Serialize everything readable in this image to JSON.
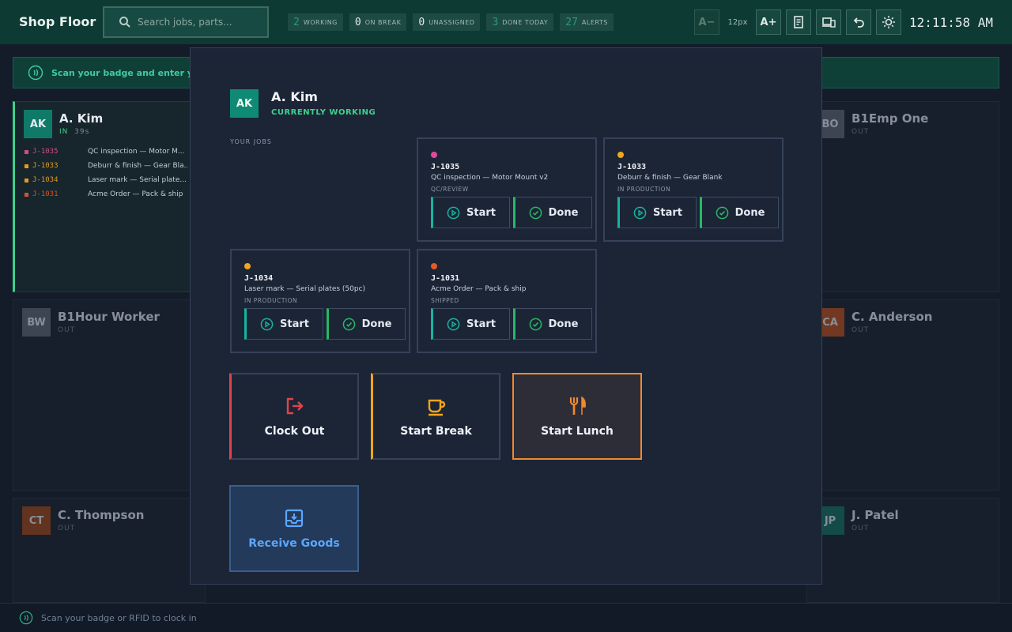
{
  "topbar": {
    "title": "Shop Floor",
    "search_placeholder": "Search jobs, parts...",
    "stats": [
      {
        "num": "2",
        "label": "WORKING"
      },
      {
        "num": "0",
        "label": "ON BREAK"
      },
      {
        "num": "0",
        "label": "UNASSIGNED"
      },
      {
        "num": "3",
        "label": "DONE TODAY"
      },
      {
        "num": "27",
        "label": "ALERTS"
      }
    ],
    "font_decrease": "A−",
    "font_size": "12px",
    "font_increase": "A+",
    "clock": "12:11:58 AM"
  },
  "banner": {
    "text": "Scan your badge and enter your PIN"
  },
  "cards": [
    {
      "initials": "AK",
      "name": "A. Kim",
      "status": "IN",
      "duration": "39s",
      "avatar_color": "#0f7a68",
      "jobs": [
        {
          "id": "J-1035",
          "desc": "QC inspection — Motor M...",
          "color": "#d04a8d"
        },
        {
          "id": "J-1033",
          "desc": "Deburr & finish — Gear Bla...",
          "color": "#e59a1b"
        },
        {
          "id": "J-1034",
          "desc": "Laser mark — Serial plate...",
          "color": "#e59a1b"
        },
        {
          "id": "J-1031",
          "desc": "Acme Order — Pack & ship",
          "color": "#d5532a"
        }
      ]
    },
    {
      "initials": "BO",
      "name": "B1Emp One",
      "status": "OUT",
      "avatar_color": "#5f6773"
    },
    {
      "initials": "BW",
      "name": "B1Hour Worker",
      "status": "OUT",
      "avatar_color": "#5f6773"
    },
    {
      "initials": "CA",
      "name": "C. Anderson",
      "status": "OUT",
      "avatar_color": "#c0501b"
    },
    {
      "initials": "CT",
      "name": "C. Thompson",
      "status": "OUT",
      "avatar_color": "#a24717"
    },
    {
      "initials": "JP",
      "name": "J. Patel",
      "status": "OUT",
      "avatar_color": "#137261"
    }
  ],
  "footer": {
    "text": "Scan your badge or RFID to clock in"
  },
  "modal": {
    "initials": "AK",
    "name": "A. Kim",
    "status": "CURRENTLY WORKING",
    "jobs_heading": "YOUR JOBS",
    "jobs": [
      {
        "id": "J-1035",
        "desc": "QC inspection — Motor Mount v2",
        "status": "QC/REVIEW",
        "color": "#e04a9a"
      },
      {
        "id": "J-1033",
        "desc": "Deburr & finish — Gear Blank",
        "status": "IN PRODUCTION",
        "color": "#f0a51c"
      },
      {
        "id": "J-1034",
        "desc": "Laser mark — Serial plates (50pc)",
        "status": "IN PRODUCTION",
        "color": "#f0a51c"
      },
      {
        "id": "J-1031",
        "desc": "Acme Order — Pack & ship",
        "status": "SHIPPED",
        "color": "#e05a28"
      }
    ],
    "start_label": "Start",
    "done_label": "Done",
    "actions": {
      "clock_out": "Clock Out",
      "start_break": "Start Break",
      "start_lunch": "Start Lunch",
      "receive_goods": "Receive Goods"
    }
  },
  "colors": {
    "accent_teal": "#16b3a0",
    "working_green": "#3fd18d",
    "clockout_red": "#e0444a",
    "break_amber": "#f2a51c",
    "lunch_orange": "#f08a2a",
    "receive_blue": "#5ea6ff"
  }
}
